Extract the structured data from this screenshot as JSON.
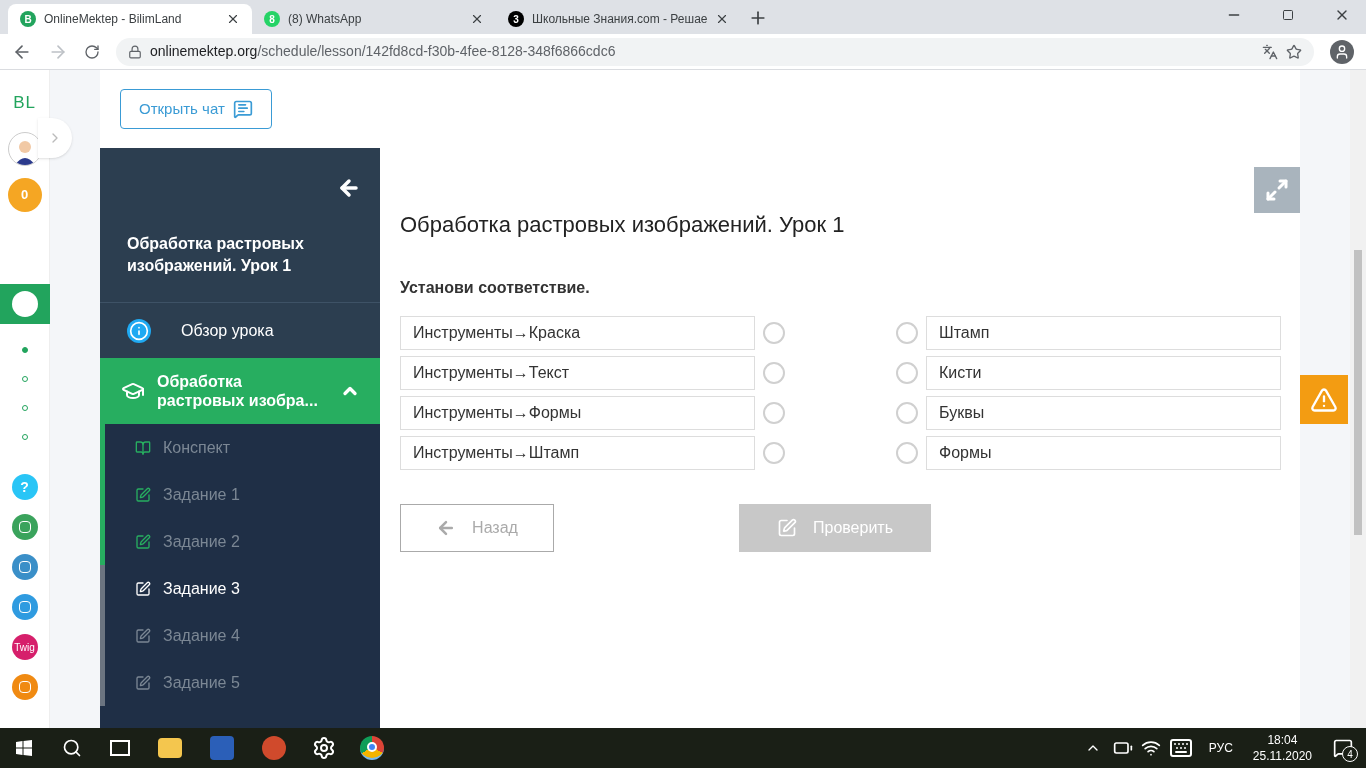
{
  "browser_tabs": [
    {
      "icon_text": "B",
      "color": "#22a45d",
      "title": "OnlineMektep - BilimLand",
      "selected": true
    },
    {
      "icon_text": "8",
      "color": "#25d366",
      "title": "(8) WhatsApp",
      "selected": false
    },
    {
      "icon_text": "3",
      "color": "#000000",
      "title": "Школьные Знания.com - Решае",
      "selected": false
    }
  ],
  "address_bar": {
    "host": "onlinemektep.org",
    "path": "/schedule/lesson/142fd8cd-f30b-4fee-8128-348f6866cdc6"
  },
  "rail": {
    "logo": "BL",
    "points_badge": "0",
    "steps": [
      {
        "selected": true
      },
      {
        "selected": false
      },
      {
        "selected": false
      },
      {
        "selected": false
      }
    ],
    "apps": [
      {
        "kind": "help",
        "label": "?",
        "color": "#29c5f6"
      },
      {
        "kind": "logo",
        "color": "#3aa35c"
      },
      {
        "kind": "logo",
        "color": "#3a8fc8"
      },
      {
        "kind": "logo",
        "color": "#2f9be0"
      },
      {
        "kind": "labeled",
        "label": "Twig",
        "color": "#d61f6b"
      },
      {
        "kind": "logo",
        "color": "#f08a12"
      }
    ]
  },
  "open_chat_button": "Открыть чат",
  "sidebar": {
    "title": "Обработка растровых изображений. Урок 1",
    "overview": "Обзор урока",
    "section": {
      "title": "Обработка растровых изобра...",
      "expanded": true
    },
    "items": [
      {
        "kind": "notes",
        "label": "Конспект",
        "done": true,
        "selected": false
      },
      {
        "kind": "task",
        "label": "Задание 1",
        "done": true,
        "selected": false
      },
      {
        "kind": "task",
        "label": "Задание 2",
        "done": true,
        "selected": false
      },
      {
        "kind": "task",
        "label": "Задание 3",
        "done": false,
        "selected": true
      },
      {
        "kind": "task",
        "label": "Задание 4",
        "done": false,
        "selected": false
      },
      {
        "kind": "task",
        "label": "Задание 5",
        "done": false,
        "selected": false
      }
    ]
  },
  "lesson_title": "Обработка растровых изображений. Урок 1",
  "instruction": "Установи соответствие.",
  "left_items": [
    {
      "text": "Инструменты→Краска",
      "selected": false
    },
    {
      "text": "Инструменты→Текст",
      "selected": false
    },
    {
      "text": "Инструменты→Формы",
      "selected": false
    },
    {
      "text": "Инструменты→Штамп",
      "selected": false
    }
  ],
  "right_items": [
    {
      "text": "Штамп",
      "selected": false
    },
    {
      "text": "Кисти",
      "selected": false
    },
    {
      "text": "Буквы",
      "selected": false
    },
    {
      "text": "Формы",
      "selected": false
    }
  ],
  "back_button": {
    "label": "Назад",
    "disabled": true
  },
  "check_button": {
    "label": "Проверить",
    "disabled": true
  },
  "taskbar": {
    "language": "РУС",
    "time": "18:04",
    "date": "25.11.2020",
    "notifications": "4"
  }
}
